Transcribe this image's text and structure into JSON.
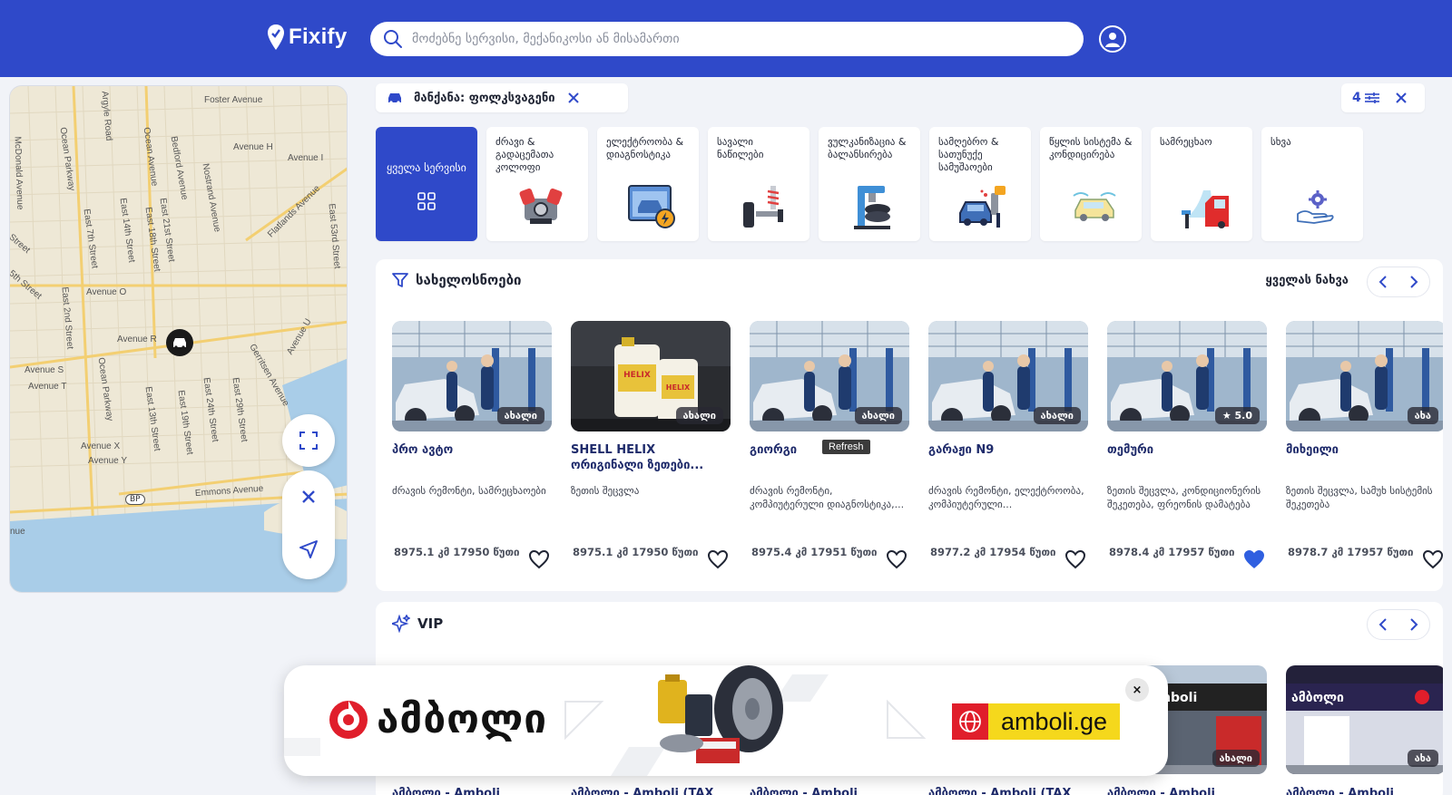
{
  "header": {
    "logo": "Fixify",
    "search_placeholder": "მოძებნე სერვისი, მექანიკოსი ან მისამართი"
  },
  "map": {
    "streets": [
      "Foster Avenue",
      "Avenue H",
      "Avenue I",
      "McDonald Avenue",
      "Ocean Parkway",
      "Argyle Road",
      "Ocean Avenue",
      "Bedford Avenue",
      "Nostrand Avenue",
      "Flatlands Avenue",
      "East 7th Street",
      "East 14th Street",
      "East 18th Street",
      "East 21st Street",
      "East 53rd Street",
      "Street",
      "5th Street",
      "Avenue O",
      "East 2nd Street",
      "Avenue R",
      "Avenue S",
      "Avenue T",
      "Avenue U",
      "Ocean Parkway",
      "East 13th Street",
      "East 19th Street",
      "East 24th Street",
      "East 29th Street",
      "Gerritsen Avenue",
      "Avenue X",
      "Avenue Y",
      "BP",
      "Emmons Avenue",
      "nue"
    ]
  },
  "filters": {
    "car_chip": "მანქანა: ფოლკსვაგენი",
    "count": "4"
  },
  "categories": [
    {
      "label": "ყველა სერვისი",
      "icon": "grid-icon",
      "active": true
    },
    {
      "label": "ძრავი & გადაცემათა კოლოფი",
      "icon": "engine-icon"
    },
    {
      "label": "ელექტროობა & დიაგნოსტიკა",
      "icon": "diagnostics-icon"
    },
    {
      "label": "სავალი ნაწილები",
      "icon": "suspension-icon"
    },
    {
      "label": "ვულკანიზაცია & ბალანსირება",
      "icon": "tire-press-icon"
    },
    {
      "label": "სამღებრო & სათუნუქე სამუშაოები",
      "icon": "paint-spray-icon"
    },
    {
      "label": "წყლის სისტემა & კონდიცირება",
      "icon": "ac-car-icon"
    },
    {
      "label": "სამრეცხაო",
      "icon": "car-wash-icon"
    },
    {
      "label": "სხვა",
      "icon": "gear-hand-icon"
    }
  ],
  "workshops": {
    "title": "სახელოსნოები",
    "see_all": "ყველას ნახვა",
    "tooltip": "Refresh",
    "cards": [
      {
        "name": "პრო ავტო",
        "badge": "ახალი",
        "desc": "ძრავის რემონტი, სამრეცხაოები",
        "dist": "8975.1 კმ 17950 წუთი",
        "fav": false,
        "img": "garage"
      },
      {
        "name": "SHELL HELIX ორიგინალი ზეთები...",
        "badge": "ახალი",
        "desc": "ზეთის შეცვლა",
        "dist": "8975.1 კმ 17950 წუთი",
        "fav": false,
        "img": "oil"
      },
      {
        "name": "გიორგი",
        "badge": "ახალი",
        "desc": "ძრავის რემონტი, კომპიუტერული დიაგნოსტიკა,...",
        "dist": "8975.4 კმ 17951 წუთი",
        "fav": false,
        "img": "garage"
      },
      {
        "name": "გარაჟი N9",
        "badge": "ახალი",
        "desc": "ძრავის რემონტი, ელექტროობა, კომპიუტერული...",
        "dist": "8977.2 კმ 17954 წუთი",
        "fav": false,
        "img": "garage"
      },
      {
        "name": "თემური",
        "badge": "★ 5.0",
        "desc": "ზეთის შეცვლა, კონდიციონერის შეკეთება, ფრეონის დამატება",
        "dist": "8978.4 კმ 17957 წუთი",
        "fav": true,
        "img": "garage"
      },
      {
        "name": "მიხეილი",
        "badge": "ახა",
        "desc": "ზეთის შეცვლა, სამუხ სისტემის შეკეთება",
        "dist": "8978.7 კმ 17957 წუთი",
        "fav": false,
        "img": "garage"
      }
    ]
  },
  "vip": {
    "title": "VIP",
    "cards": [
      {
        "name": "ამბოლი - Amboli"
      },
      {
        "name": "ამბოლი - Amboli (TAX"
      },
      {
        "name": "ამბოლი - Amboli"
      },
      {
        "name": "ამბოლი - Amboli (TAX"
      },
      {
        "name": "ამბოლი - Amboli",
        "badge": "ახალი",
        "store_sign": "amboli"
      },
      {
        "name": "ამბოლი - Amboli",
        "badge": "ახა",
        "store_sign": "ამბოლი"
      }
    ]
  },
  "ad": {
    "brand": "ამბოლი",
    "url": "amboli.ge",
    "close": "×"
  },
  "colors": {
    "primary": "#2f49c9",
    "fav": "#2f5fe0"
  }
}
